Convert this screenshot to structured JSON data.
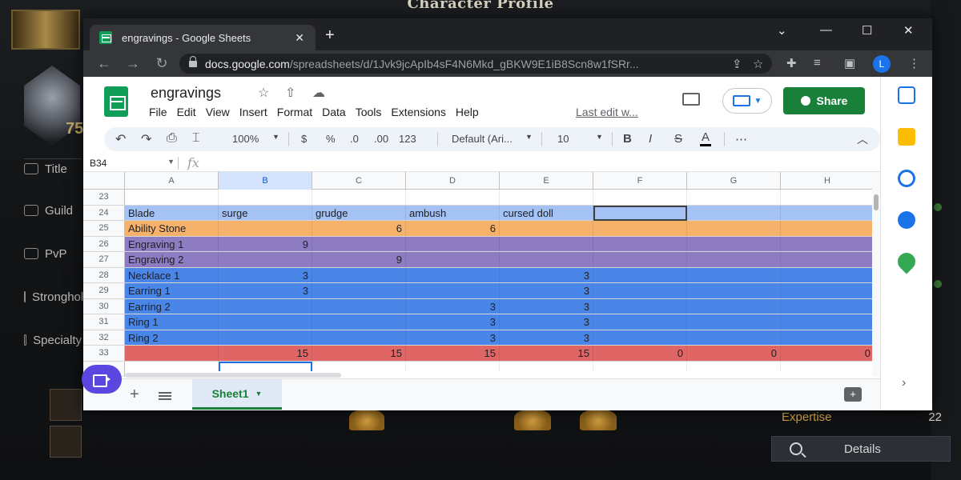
{
  "game": {
    "title": "Character Profile",
    "close": "✕",
    "rank_number": "75",
    "side_items": [
      "Title",
      "Guild",
      "PvP",
      "Stronghold",
      "Specialty"
    ],
    "expertise_label": "Expertise",
    "expertise_value": "22",
    "details_label": "Details"
  },
  "browser": {
    "tab_title": "engravings - Google Sheets",
    "tab_close": "✕",
    "new_tab": "+",
    "url_domain": "docs.google.com",
    "url_path": "/spreadsheets/d/1Jvk9jcApIb4sF4N6Mkd_gBKW9E1iB8Scn8w1fSRr...",
    "profile_initial": "L",
    "window_controls": [
      "⌄",
      "—",
      "☐",
      "✕"
    ]
  },
  "sheets": {
    "doc_title": "engravings",
    "menu": [
      "File",
      "Edit",
      "View",
      "Insert",
      "Format",
      "Data",
      "Tools",
      "Extensions",
      "Help"
    ],
    "last_edit": "Last edit w...",
    "share_label": "Share",
    "user_initial": "L",
    "toolbar": {
      "zoom": "100%",
      "currency": "$",
      "percent": "%",
      "dec_decrease": ".0",
      "dec_increase": ".00",
      "number_format": "123",
      "font": "Default (Ari...",
      "font_size": "10",
      "bold": "B",
      "italic": "I",
      "strike": "S",
      "text_color": "A",
      "more": "⋯"
    },
    "name_box": "B34",
    "fx": "fx",
    "columns": [
      "A",
      "B",
      "C",
      "D",
      "E",
      "F",
      "G",
      "H"
    ],
    "rows": [
      {
        "n": "23",
        "cells": [
          "",
          "",
          "",
          "",
          "",
          "",
          "",
          ""
        ],
        "color": "#ffffff"
      },
      {
        "n": "24",
        "cells": [
          "Blade",
          "surge",
          "grudge",
          "ambush",
          "cursed doll",
          "",
          "",
          ""
        ],
        "color": "#a4c2f4"
      },
      {
        "n": "25",
        "cells": [
          "Ability Stone",
          "",
          "6",
          "6",
          "",
          "",
          "",
          ""
        ],
        "color": "#f6b26b"
      },
      {
        "n": "26",
        "cells": [
          "Engraving 1",
          "9",
          "",
          "",
          "",
          "",
          "",
          ""
        ],
        "color": "#8e7cc3"
      },
      {
        "n": "27",
        "cells": [
          "Engraving 2",
          "",
          "9",
          "",
          "",
          "",
          "",
          ""
        ],
        "color": "#8e7cc3"
      },
      {
        "n": "28",
        "cells": [
          "Necklace 1",
          "3",
          "",
          "",
          "3",
          "",
          "",
          ""
        ],
        "color": "#4a86e8"
      },
      {
        "n": "29",
        "cells": [
          "Earring 1",
          "3",
          "",
          "",
          "3",
          "",
          "",
          ""
        ],
        "color": "#4a86e8"
      },
      {
        "n": "30",
        "cells": [
          "Earring 2",
          "",
          "",
          "3",
          "3",
          "",
          "",
          ""
        ],
        "color": "#4a86e8"
      },
      {
        "n": "31",
        "cells": [
          "Ring 1",
          "",
          "",
          "3",
          "3",
          "",
          "",
          ""
        ],
        "color": "#4a86e8"
      },
      {
        "n": "32",
        "cells": [
          "Ring 2",
          "",
          "",
          "3",
          "3",
          "",
          "",
          ""
        ],
        "color": "#4a86e8"
      },
      {
        "n": "33",
        "cells": [
          "",
          "15",
          "15",
          "15",
          "15",
          "0",
          "0",
          "0"
        ],
        "color": "#e06666"
      },
      {
        "n": "34",
        "cells": [
          "",
          "",
          "",
          "",
          "",
          "",
          "",
          ""
        ],
        "color": "#ffffff"
      }
    ],
    "sheet_tab": "Sheet1"
  }
}
